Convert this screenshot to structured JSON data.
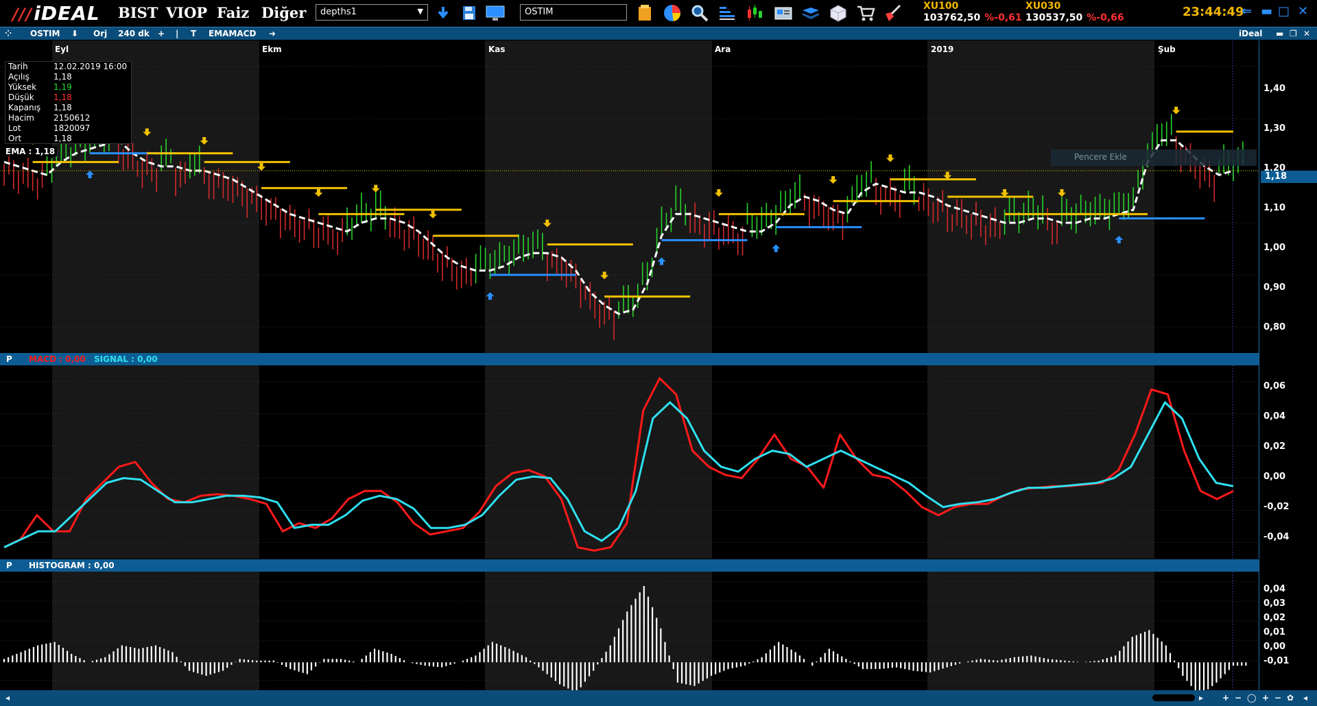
{
  "app": {
    "logo": "iDEAL",
    "menu": [
      "BIST",
      "VIOP",
      "Faiz",
      "Diğer"
    ],
    "layout_select": "depths1",
    "symbol_input": "OSTIM",
    "clock": "23:44:49"
  },
  "tickers": [
    {
      "name": "XU100",
      "value": "103762,50",
      "change": "%-0,61"
    },
    {
      "name": "XU030",
      "value": "130537,50",
      "change": "%-0,66"
    }
  ],
  "chart_toolbar": {
    "symbol": "OSTIM",
    "mode": "Orj",
    "period": "240 dk",
    "indicator": "EMAMACD",
    "brand": "iDeal"
  },
  "colors": {
    "up": "#27d42a",
    "down": "#d42a2a",
    "ema": "#ffffff",
    "buy": "#2b8fff",
    "sell": "#f2c200",
    "macd": "#ff1a1a",
    "signal": "#2fe0f0",
    "histogram": "#ffffff",
    "accent": "#0d5d94"
  },
  "info": {
    "rows": [
      {
        "k": "Tarih",
        "v": "12.02.2019 16:00",
        "c": ""
      },
      {
        "k": "Açılış",
        "v": "1,18",
        "c": ""
      },
      {
        "k": "Yüksek",
        "v": "1,19",
        "c": "green"
      },
      {
        "k": "Düşük",
        "v": "1,18",
        "c": "red"
      },
      {
        "k": "Kapanış",
        "v": "1,18",
        "c": ""
      },
      {
        "k": "Hacim",
        "v": "2150612",
        "c": ""
      },
      {
        "k": "Lot",
        "v": "1820097",
        "c": ""
      },
      {
        "k": "Ort",
        "v": "1,18",
        "c": ""
      }
    ],
    "ema": "EMA : 1,18",
    "last_price": "1,18",
    "ghost_tip": "Pencere Ekle"
  },
  "months": [
    "Eyl",
    "Ekm",
    "Kas",
    "Ara",
    "2019",
    "Şub"
  ],
  "price_axis": [
    "1,40",
    "1,30",
    "1,20",
    "1,10",
    "1,00",
    "0,90",
    "0,80"
  ],
  "macd_pane": {
    "prefix": "P",
    "macd_label": "MACD : 0,00",
    "signal_label": "SIGNAL : 0,00",
    "axis": [
      "0,06",
      "0,04",
      "0,02",
      "0,00",
      "-0,02",
      "-0,04"
    ]
  },
  "hist_pane": {
    "prefix": "P",
    "label": "HISTOGRAM : 0,00",
    "axis": [
      "0,04",
      "0,03",
      "0,02",
      "0,01",
      "0,00",
      "-0,01"
    ]
  },
  "chart_data": {
    "type": "line",
    "x_months": [
      "Eyl",
      "Ekm",
      "Kas",
      "Ara",
      "2019",
      "Şub"
    ],
    "price": {
      "ylim": [
        0.76,
        1.48
      ],
      "ema": [
        1.2,
        1.19,
        1.18,
        1.17,
        1.2,
        1.22,
        1.23,
        1.24,
        1.25,
        1.22,
        1.2,
        1.19,
        1.19,
        1.18,
        1.18,
        1.17,
        1.16,
        1.14,
        1.12,
        1.1,
        1.08,
        1.07,
        1.06,
        1.05,
        1.04,
        1.06,
        1.07,
        1.07,
        1.06,
        1.04,
        1.01,
        0.98,
        0.96,
        0.95,
        0.95,
        0.96,
        0.98,
        0.99,
        0.99,
        0.98,
        0.95,
        0.9,
        0.87,
        0.85,
        0.86,
        0.92,
        1.03,
        1.08,
        1.08,
        1.07,
        1.06,
        1.05,
        1.04,
        1.04,
        1.06,
        1.1,
        1.12,
        1.11,
        1.09,
        1.08,
        1.13,
        1.15,
        1.14,
        1.13,
        1.13,
        1.12,
        1.1,
        1.09,
        1.08,
        1.07,
        1.06,
        1.06,
        1.07,
        1.07,
        1.06,
        1.06,
        1.07,
        1.07,
        1.08,
        1.09,
        1.2,
        1.25,
        1.25,
        1.22,
        1.19,
        1.17,
        1.18
      ]
    },
    "series": [
      {
        "name": "MACD",
        "ylim": [
          -0.047,
          0.073
        ],
        "values": [
          -0.04,
          -0.035,
          -0.02,
          -0.03,
          -0.03,
          -0.01,
          0.0,
          0.01,
          0.013,
          0.0,
          -0.01,
          -0.012,
          -0.008,
          -0.007,
          -0.008,
          -0.01,
          -0.013,
          -0.03,
          -0.025,
          -0.028,
          -0.022,
          -0.01,
          -0.005,
          -0.005,
          -0.012,
          -0.025,
          -0.032,
          -0.03,
          -0.028,
          -0.018,
          -0.002,
          0.006,
          0.008,
          0.004,
          -0.01,
          -0.04,
          -0.042,
          -0.04,
          -0.025,
          0.045,
          0.065,
          0.055,
          0.02,
          0.01,
          0.005,
          0.003,
          0.015,
          0.03,
          0.015,
          0.01,
          -0.003,
          0.03,
          0.015,
          0.005,
          0.003,
          -0.005,
          -0.015,
          -0.02,
          -0.015,
          -0.013,
          -0.013,
          -0.008,
          -0.004,
          -0.003,
          -0.002,
          -0.002,
          -0.001,
          0.0,
          0.008,
          0.03,
          0.058,
          0.055,
          0.02,
          -0.005,
          -0.01,
          -0.005
        ]
      },
      {
        "name": "SIGNAL",
        "ylim": [
          -0.047,
          0.073
        ],
        "values": [
          -0.04,
          -0.035,
          -0.03,
          -0.03,
          -0.02,
          -0.01,
          0.0,
          0.003,
          0.002,
          -0.005,
          -0.012,
          -0.012,
          -0.01,
          -0.008,
          -0.008,
          -0.009,
          -0.012,
          -0.028,
          -0.026,
          -0.026,
          -0.02,
          -0.011,
          -0.008,
          -0.01,
          -0.016,
          -0.028,
          -0.028,
          -0.026,
          -0.02,
          -0.008,
          0.002,
          0.004,
          0.003,
          -0.01,
          -0.03,
          -0.036,
          -0.028,
          -0.005,
          0.04,
          0.05,
          0.04,
          0.02,
          0.01,
          0.007,
          0.015,
          0.02,
          0.018,
          0.01,
          0.015,
          0.02,
          0.015,
          0.01,
          0.005,
          0.0,
          -0.008,
          -0.015,
          -0.013,
          -0.012,
          -0.01,
          -0.006,
          -0.003,
          -0.003,
          -0.002,
          -0.001,
          0.0,
          0.003,
          0.01,
          0.03,
          0.05,
          0.04,
          0.015,
          0.0,
          -0.002
        ]
      },
      {
        "name": "HISTOGRAM",
        "ylim": [
          -0.0165,
          0.0535
        ],
        "values": [
          0.002,
          0.006,
          0.01,
          0.012,
          0.005,
          0.0,
          0.003,
          0.01,
          0.008,
          0.01,
          0.006,
          -0.005,
          -0.008,
          -0.005,
          0.002,
          0.001,
          0.001,
          -0.004,
          -0.007,
          0.002,
          0.002,
          0.0,
          0.008,
          0.005,
          0.0,
          -0.002,
          -0.003,
          0.0,
          0.004,
          0.012,
          0.008,
          0.003,
          -0.005,
          -0.013,
          -0.018,
          -0.005,
          0.01,
          0.03,
          0.045,
          0.02,
          -0.012,
          -0.014,
          -0.008,
          -0.004,
          -0.002,
          0.003,
          0.012,
          0.006,
          -0.002,
          0.008,
          0.002,
          -0.004,
          -0.004,
          -0.003,
          -0.005,
          -0.006,
          -0.003,
          0.0,
          0.002,
          0.001,
          0.003,
          0.004,
          0.002,
          0.001,
          0.0,
          0.001,
          0.004,
          0.015,
          0.019,
          0.01,
          -0.008,
          -0.02,
          -0.012,
          -0.002
        ]
      }
    ]
  }
}
